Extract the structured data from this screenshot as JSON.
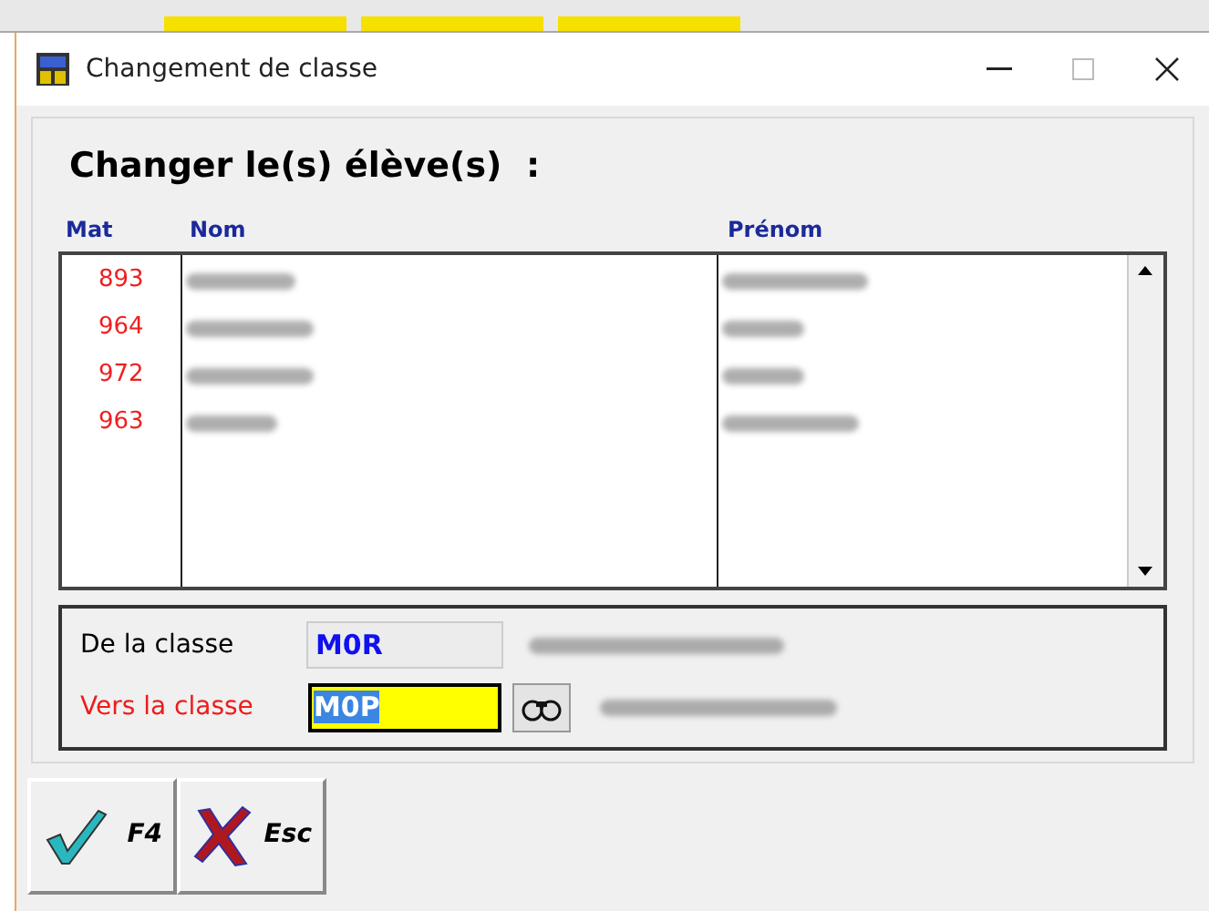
{
  "window": {
    "title": "Changement de classe"
  },
  "heading": "Changer le(s) élève(s)  :",
  "table": {
    "columns": [
      "Mat",
      "Nom",
      "Prénom"
    ],
    "rows": [
      {
        "mat": "893"
      },
      {
        "mat": "964"
      },
      {
        "mat": "972"
      },
      {
        "mat": "963"
      }
    ]
  },
  "from_class": {
    "label": "De la classe",
    "value": "M0R"
  },
  "to_class": {
    "label": "Vers la classe",
    "value": "M0P",
    "highlighted": true
  },
  "buttons": [
    {
      "kind": "ok",
      "label": "F4"
    },
    {
      "kind": "cancel",
      "label": "Esc"
    }
  ]
}
